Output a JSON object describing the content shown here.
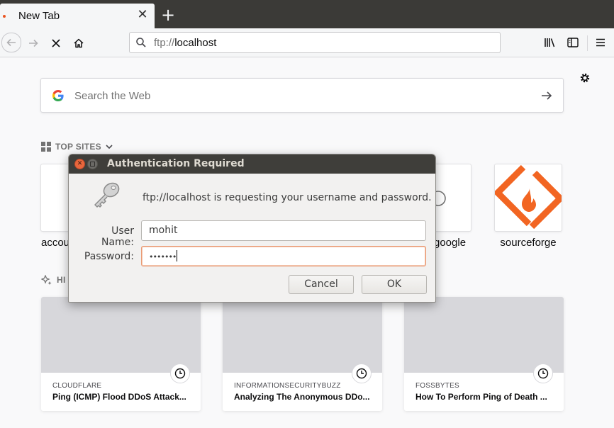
{
  "browser": {
    "tab_title": "New Tab",
    "tab_close_glyph": "✕",
    "new_tab_glyph": "+",
    "url_scheme": "ftp://",
    "url_host": "localhost",
    "accent_color": "#e95420"
  },
  "newtab": {
    "search_placeholder": "Search the Web",
    "top_sites_label": "TOP SITES",
    "highlights_label_visible": "HI",
    "top_sites": [
      {
        "label": "accou"
      },
      {
        "label": "google"
      },
      {
        "label": "sourceforge"
      }
    ],
    "highlights": [
      {
        "source": "CLOUDFLARE",
        "title": "Ping (ICMP) Flood DDoS Attack..."
      },
      {
        "source": "INFORMATIONSECURITYBUZZ",
        "title": "Analyzing The Anonymous DDo..."
      },
      {
        "source": "FOSSBYTES",
        "title": "How To Perform Ping of Death ..."
      }
    ]
  },
  "dialog": {
    "title": "Authentication Required",
    "message": "ftp://localhost is requesting your username and password.",
    "username_label": "User Name:",
    "username_value": "mohit",
    "password_label": "Password:",
    "password_value": "•••••••",
    "cancel_label": "Cancel",
    "ok_label": "OK",
    "close_glyph": "✕"
  }
}
